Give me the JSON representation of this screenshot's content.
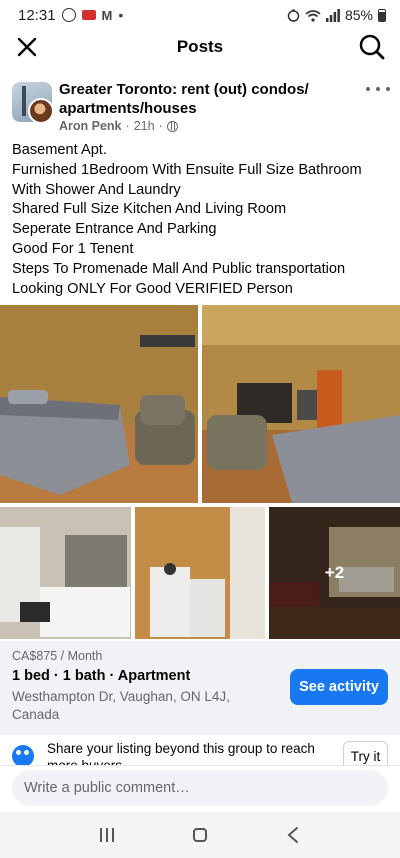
{
  "status_bar": {
    "time": "12:31",
    "battery": "85%",
    "icons": [
      "whatsapp-icon",
      "notification-icon",
      "gmail-icon",
      "dot-icon",
      "alarm-icon",
      "wifi-icon",
      "signal-icon",
      "battery-icon"
    ]
  },
  "header": {
    "title": "Posts",
    "close_icon": "close-icon",
    "search_icon": "search-icon"
  },
  "post": {
    "group_name": "Greater Toronto: rent (out) condos/ apartments/houses",
    "author": "Aron Penk",
    "time": "21h",
    "separator": "·",
    "body_lines": [
      "Basement Apt.",
      "Furnished 1Bedroom With Ensuite Full Size  Bathroom",
      "With Shower And Laundry",
      "Shared Full Size Kitchen And Living Room",
      "Seperate Entrance And Parking",
      "Good For 1 Tenent",
      "Steps To Promenade Mall And Public transportation",
      "Looking ONLY For Good VERIFIED Person"
    ],
    "more_photos_label": "+2"
  },
  "listing": {
    "price": "CA$875 / Month",
    "title": "1 bed · 1 bath · Apartment",
    "location": "Westhampton Dr, Vaughan, ON L4J, Canada",
    "button_label": "See activity"
  },
  "share": {
    "text": "Share your listing beyond this group to reach more buyers",
    "button_label": "Try it"
  },
  "comment": {
    "placeholder": "Write a public comment…"
  },
  "colors": {
    "accent": "#1877f2",
    "secondary_text": "#65676b",
    "listing_bg": "#f0f2f5"
  }
}
